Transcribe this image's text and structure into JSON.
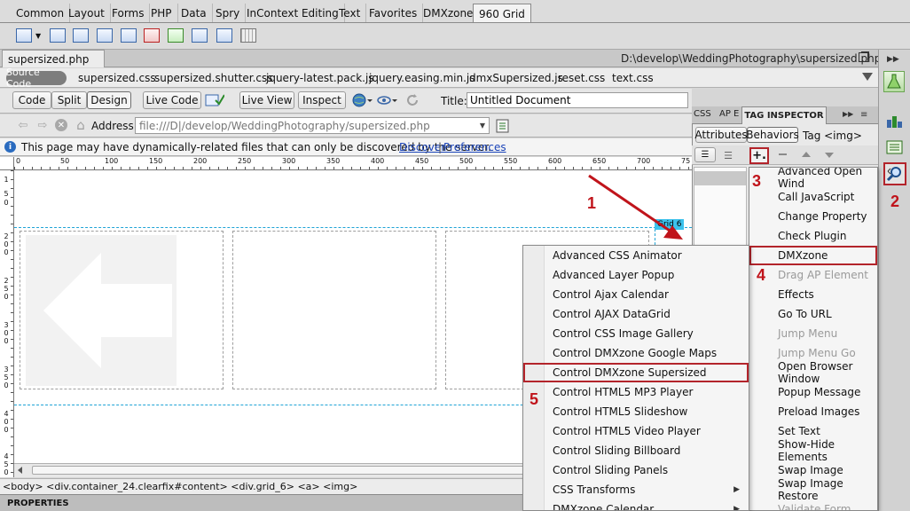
{
  "insert_tabs": [
    "Common",
    "Layout",
    "Forms",
    "PHP",
    "Data",
    "Spry",
    "InContext Editing",
    "Text",
    "Favorites",
    "DMXzone",
    "960 Grid"
  ],
  "document": {
    "tab_label": "supersized.php",
    "path": "D:\\develop\\WeddingPhotography\\supersized.php"
  },
  "related_files": {
    "source_code": "Source Code",
    "files": [
      "supersized.css",
      "supersized.shutter.css",
      "jquery-latest.pack.js",
      "jquery.easing.min.js",
      "dmxSupersized.js",
      "reset.css",
      "text.css"
    ]
  },
  "doc_toolbar": {
    "code": "Code",
    "split": "Split",
    "design": "Design",
    "live_code": "Live Code",
    "live_view": "Live View",
    "inspect": "Inspect",
    "title_label": "Title:",
    "title_value": "Untitled Document"
  },
  "address_bar": {
    "label": "Address:",
    "value": "file:///D|/develop/WeddingPhotography/supersized.php"
  },
  "info_bar": {
    "message": "This page may have dynamically-related files that can only be discovered by the server.",
    "discover": "Discover",
    "separator": "|",
    "preferences": "Preferences"
  },
  "ruler": {
    "labels": [
      "0",
      "50",
      "100",
      "150",
      "200",
      "250",
      "300",
      "350",
      "400",
      "450",
      "500",
      "550",
      "600",
      "650",
      "700",
      "75"
    ],
    "vertical": [
      "1",
      "5",
      "0",
      "2",
      "0",
      "0",
      "2",
      "5",
      "0",
      "3",
      "0",
      "0",
      "3",
      "5",
      "0",
      "4",
      "0",
      "0",
      "4",
      "5",
      "0"
    ]
  },
  "design_view": {
    "grid_badge": "Grid 6"
  },
  "status_bar": {
    "tag_path": "<body> <div.container_24.clearfix#content> <div.grid_6> <a> <img>"
  },
  "properties_label": "PROPERTIES",
  "panel": {
    "tabs": [
      "CSS",
      "AP E",
      "TAG INSPECTOR"
    ],
    "sub_tabs": [
      "Attributes",
      "Behaviors"
    ],
    "tag_label": "Tag <img>",
    "add_button": "+."
  },
  "behaviors_menu": [
    {
      "label": "Advanced Open Wind",
      "disabled": false
    },
    {
      "label": "Call JavaScript",
      "disabled": false
    },
    {
      "label": "Change Property",
      "disabled": false
    },
    {
      "label": "Check Plugin",
      "disabled": false
    },
    {
      "label": "DMXzone",
      "disabled": false
    },
    {
      "label": "Drag AP Element",
      "disabled": true
    },
    {
      "label": "Effects",
      "disabled": false
    },
    {
      "label": "Go To URL",
      "disabled": false
    },
    {
      "label": "Jump Menu",
      "disabled": true
    },
    {
      "label": "Jump Menu Go",
      "disabled": true
    },
    {
      "label": "Open Browser Window",
      "disabled": false
    },
    {
      "label": "Popup Message",
      "disabled": false
    },
    {
      "label": "Preload Images",
      "disabled": false
    },
    {
      "label": "Set Text",
      "disabled": false
    },
    {
      "label": "Show-Hide Elements",
      "disabled": false
    },
    {
      "label": "Swap Image",
      "disabled": false
    },
    {
      "label": "Swap Image Restore",
      "disabled": false
    },
    {
      "label": "Validate Form",
      "disabled": true
    }
  ],
  "dmxzone_submenu": [
    {
      "label": "Advanced CSS Animator",
      "has_submenu": false
    },
    {
      "label": "Advanced Layer Popup",
      "has_submenu": false
    },
    {
      "label": "Control Ajax Calendar",
      "has_submenu": false
    },
    {
      "label": "Control AJAX DataGrid",
      "has_submenu": false
    },
    {
      "label": "Control CSS Image Gallery",
      "has_submenu": false
    },
    {
      "label": "Control DMXzone Google Maps",
      "has_submenu": false
    },
    {
      "label": "Control DMXzone Supersized",
      "has_submenu": false
    },
    {
      "label": "Control HTML5 MP3 Player",
      "has_submenu": false
    },
    {
      "label": "Control HTML5 Slideshow",
      "has_submenu": false
    },
    {
      "label": "Control HTML5 Video Player",
      "has_submenu": false
    },
    {
      "label": "Control Sliding Billboard",
      "has_submenu": false
    },
    {
      "label": "Control Sliding Panels",
      "has_submenu": false
    },
    {
      "label": "CSS Transforms",
      "has_submenu": true
    },
    {
      "label": "DMXzone Calendar",
      "has_submenu": true
    }
  ],
  "annotations": [
    "1",
    "2",
    "3",
    "4",
    "5"
  ],
  "colors": {
    "highlight_red": "#b3242b",
    "annotation_red": "#c0141b",
    "guide_cyan": "#1fa3d6"
  }
}
